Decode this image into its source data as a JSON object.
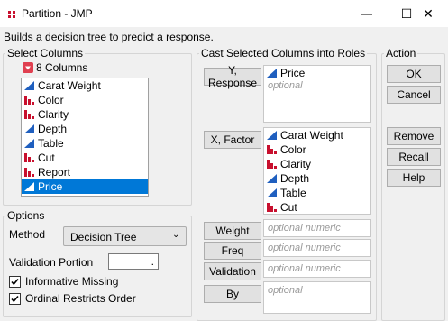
{
  "window": {
    "title": "Partition - JMP",
    "minimize": "—",
    "maximize": "☐",
    "close": "✕"
  },
  "subtitle": "Builds a decision tree to predict a response.",
  "select_columns": {
    "legend": "Select Columns",
    "count_label": "8 Columns",
    "items": [
      {
        "label": "Carat Weight",
        "icon": "continuous-icon"
      },
      {
        "label": "Color",
        "icon": "nominal-icon"
      },
      {
        "label": "Clarity",
        "icon": "nominal-icon"
      },
      {
        "label": "Depth",
        "icon": "continuous-icon"
      },
      {
        "label": "Table",
        "icon": "continuous-icon"
      },
      {
        "label": "Cut",
        "icon": "nominal-icon"
      },
      {
        "label": "Report",
        "icon": "nominal-icon"
      },
      {
        "label": "Price",
        "icon": "continuous-icon",
        "selected": true
      }
    ]
  },
  "roles": {
    "legend": "Cast Selected Columns into Roles",
    "y_response": {
      "button": "Y, Response",
      "items": [
        "Price"
      ],
      "placeholder": "optional"
    },
    "x_factor": {
      "button": "X, Factor",
      "items": [
        "Carat Weight",
        "Color",
        "Clarity",
        "Depth",
        "Table",
        "Cut"
      ]
    },
    "weight": {
      "button": "Weight",
      "placeholder": "optional numeric"
    },
    "freq": {
      "button": "Freq",
      "placeholder": "optional numeric"
    },
    "validation": {
      "button": "Validation",
      "placeholder": "optional numeric"
    },
    "by": {
      "button": "By",
      "placeholder": "optional"
    }
  },
  "action": {
    "legend": "Action",
    "ok": "OK",
    "cancel": "Cancel",
    "remove": "Remove",
    "recall": "Recall",
    "help": "Help"
  },
  "options": {
    "legend": "Options",
    "method_label": "Method",
    "method_value": "Decision Tree",
    "validation_portion_label": "Validation Portion",
    "validation_portion_value": ".",
    "informative_missing": {
      "label": "Informative Missing",
      "checked": true
    },
    "ordinal_restricts_order": {
      "label": "Ordinal Restricts Order",
      "checked": true
    }
  },
  "colors": {
    "continuous": "#1f5fbf",
    "nominal": "#c8102e",
    "selection": "#0078d7"
  }
}
